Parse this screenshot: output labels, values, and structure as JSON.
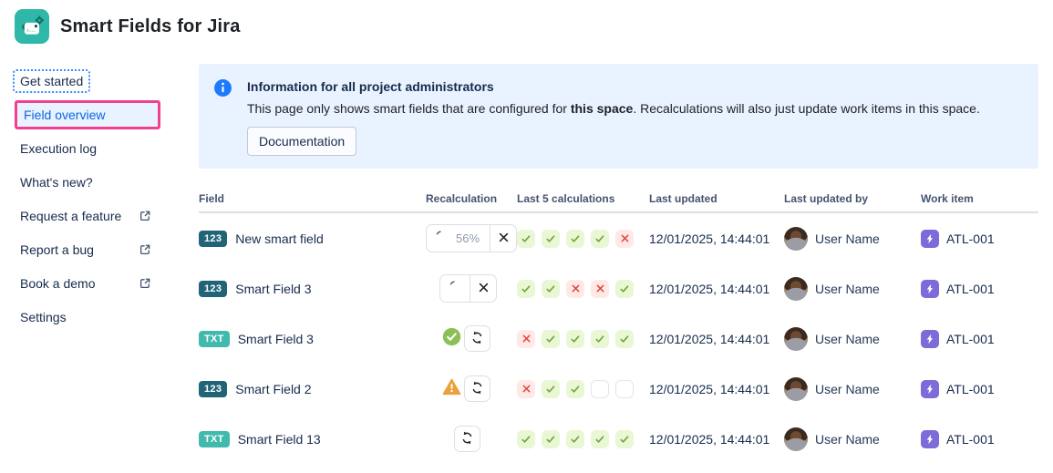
{
  "app": {
    "title": "Smart Fields for Jira",
    "logo_icon": "robot-gear-icon"
  },
  "sidebar": {
    "items": [
      {
        "label": "Get started",
        "state": "focused",
        "external": false
      },
      {
        "label": "Field overview",
        "state": "selected",
        "external": false
      },
      {
        "label": "Execution log",
        "state": "default",
        "external": false
      },
      {
        "label": "What's new?",
        "state": "default",
        "external": false
      },
      {
        "label": "Request a feature",
        "state": "default",
        "external": true
      },
      {
        "label": "Report a bug",
        "state": "default",
        "external": true
      },
      {
        "label": "Book a demo",
        "state": "default",
        "external": true
      },
      {
        "label": "Settings",
        "state": "default",
        "external": false
      }
    ]
  },
  "banner": {
    "icon": "info-icon",
    "title": "Information for all project administrators",
    "body_prefix": "This page only shows smart fields that are configured for ",
    "body_bold": "this space",
    "body_suffix": ". Recalculations will also just update work items in this space.",
    "button_label": "Documentation"
  },
  "table": {
    "columns": [
      "Field",
      "Recalculation",
      "Last 5 calculations",
      "Last updated",
      "Last updated by",
      "Work item"
    ],
    "rows": [
      {
        "badge": "123",
        "badge_variant": "number",
        "name": "New smart field",
        "recalc": {
          "mode": "progress",
          "percent": "56%"
        },
        "last5": [
          "pass",
          "pass",
          "pass",
          "pass",
          "fail"
        ],
        "last_updated": "12/01/2025, 14:44:01",
        "updated_by": "User Name",
        "work_item": "ATL-001"
      },
      {
        "badge": "123",
        "badge_variant": "number",
        "name": "Smart Field 3",
        "recalc": {
          "mode": "progress",
          "percent": ""
        },
        "last5": [
          "pass",
          "pass",
          "fail",
          "fail",
          "pass"
        ],
        "last_updated": "12/01/2025, 14:44:01",
        "updated_by": "User Name",
        "work_item": "ATL-001"
      },
      {
        "badge": "TXT",
        "badge_variant": "text",
        "name": "Smart Field 3",
        "recalc": {
          "mode": "done-success"
        },
        "last5": [
          "fail",
          "pass",
          "pass",
          "pass",
          "pass"
        ],
        "last_updated": "12/01/2025, 14:44:01",
        "updated_by": "User Name",
        "work_item": "ATL-001"
      },
      {
        "badge": "123",
        "badge_variant": "number",
        "name": "Smart Field 2",
        "recalc": {
          "mode": "done-warning"
        },
        "last5": [
          "fail",
          "pass",
          "pass",
          "empty",
          "empty"
        ],
        "last_updated": "12/01/2025, 14:44:01",
        "updated_by": "User Name",
        "work_item": "ATL-001"
      },
      {
        "badge": "TXT",
        "badge_variant": "text",
        "name": "Smart Field 13",
        "recalc": {
          "mode": "idle"
        },
        "last5": [
          "pass",
          "pass",
          "pass",
          "pass",
          "pass"
        ],
        "last_updated": "12/01/2025, 14:44:01",
        "updated_by": "User Name",
        "work_item": "ATL-001"
      }
    ]
  },
  "colors": {
    "accent_blue": "#0C66E4",
    "selected_bg": "#E9F2FF",
    "banner_bg": "#E9F2FF",
    "info_icon": "#1D7AFC",
    "annotation_pink": "#F0418C",
    "badge_number": "#216477",
    "badge_text": "#41BAAD",
    "success_chip_bg": "#E9F7D4",
    "success_icon": "#74A53C",
    "fail_chip_bg": "#FFE9E6",
    "fail_icon": "#E0483E",
    "status_success": "#8CBF55",
    "warning": "#E9A13B",
    "work_item_purple": "#7E6BD9",
    "text_primary": "#172B4D",
    "text_secondary": "#44546F",
    "border_gray": "#DCDFE4",
    "app_teal": "#2FB8A9"
  }
}
